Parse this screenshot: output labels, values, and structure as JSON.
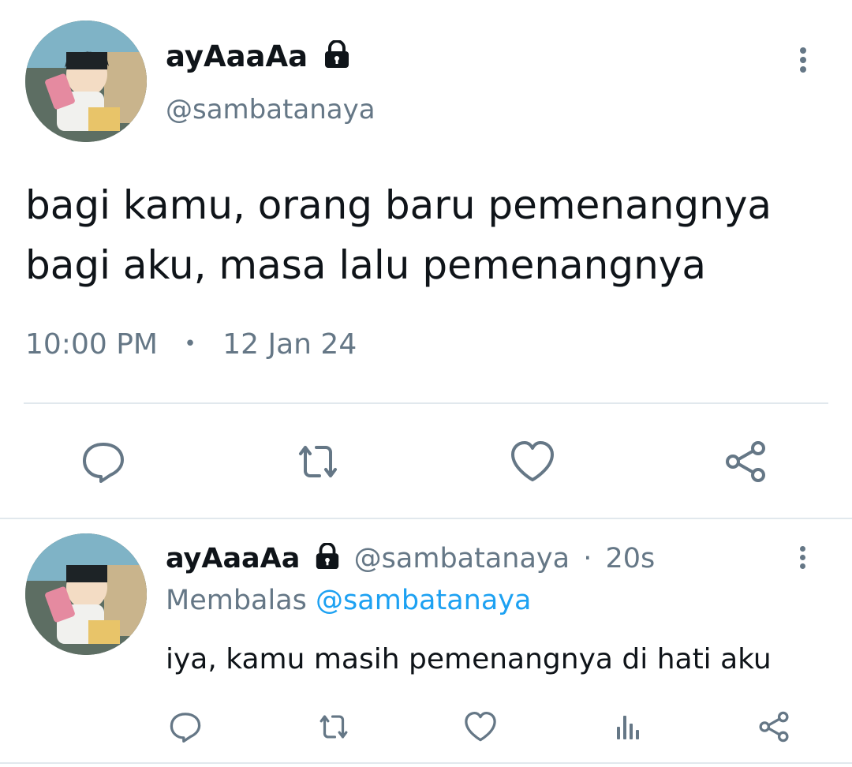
{
  "tweet": {
    "display_name": "ayAaaAa",
    "handle": "@sambatanaya",
    "text_line1": "bagi kamu, orang baru pemenangnya",
    "text_line2": "bagi aku, masa lalu pemenangnya",
    "time": "10:00 PM",
    "separator": "•",
    "date": "12 Jan 24"
  },
  "actions": {
    "icons": [
      "comment-icon",
      "retweet-icon",
      "like-icon",
      "share-icon"
    ]
  },
  "reply": {
    "display_name": "ayAaaAa",
    "handle": "@sambatanaya",
    "dot": "·",
    "age": "20s",
    "replying_prefix": "Membalas",
    "replying_handle": "@sambatanaya",
    "text": "iya, kamu masih pemenangnya di hati aku",
    "icons": [
      "comment-icon",
      "retweet-icon",
      "like-icon",
      "analytics-icon",
      "share-icon"
    ]
  },
  "colors": {
    "text": "#0f1419",
    "muted": "#657786",
    "link": "#1da1f2",
    "divider": "#e1e8ed"
  }
}
